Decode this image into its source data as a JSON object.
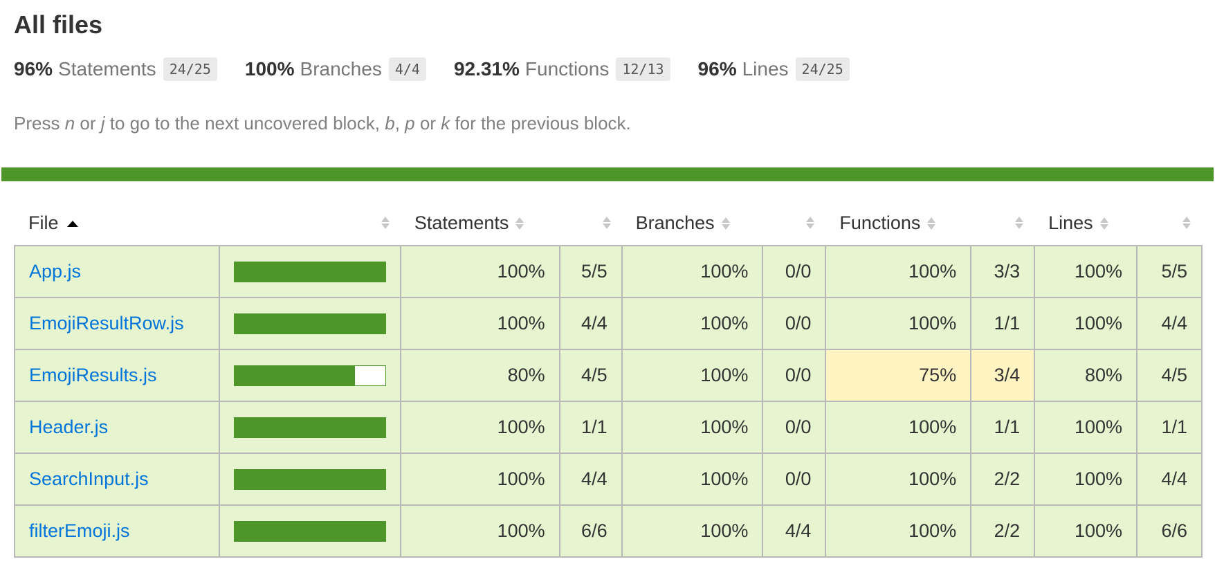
{
  "title": "All files",
  "summary": [
    {
      "pct": "96%",
      "label": "Statements",
      "frac": "24/25"
    },
    {
      "pct": "100%",
      "label": "Branches",
      "frac": "4/4"
    },
    {
      "pct": "92.31%",
      "label": "Functions",
      "frac": "12/13"
    },
    {
      "pct": "96%",
      "label": "Lines",
      "frac": "24/25"
    }
  ],
  "hint": {
    "t1": "Press ",
    "k1": "n",
    "t2": " or ",
    "k2": "j",
    "t3": " to go to the next uncovered block, ",
    "k3": "b",
    "t4": ", ",
    "k4": "p",
    "t5": " or ",
    "k5": "k",
    "t6": " for the previous block."
  },
  "columns": {
    "file": "File",
    "statements": "Statements",
    "branches": "Branches",
    "functions": "Functions",
    "lines": "Lines"
  },
  "colors": {
    "high": "#4f962a",
    "high_bg": "#e6f5d0",
    "medium_bg": "#fff4c2",
    "link": "#0074d9"
  },
  "rows": [
    {
      "file": "App.js",
      "coverage": 1.0,
      "stmt_pct": "100%",
      "stmt": "5/5",
      "br_pct": "100%",
      "br": "0/0",
      "fn_pct": "100%",
      "fn": "3/3",
      "ln_pct": "100%",
      "ln": "5/5"
    },
    {
      "file": "EmojiResultRow.js",
      "coverage": 1.0,
      "stmt_pct": "100%",
      "stmt": "4/4",
      "br_pct": "100%",
      "br": "0/0",
      "fn_pct": "100%",
      "fn": "1/1",
      "ln_pct": "100%",
      "ln": "4/4"
    },
    {
      "file": "EmojiResults.js",
      "coverage": 0.8,
      "stmt_pct": "80%",
      "stmt": "4/5",
      "br_pct": "100%",
      "br": "0/0",
      "fn_pct": "75%",
      "fn": "3/4",
      "ln_pct": "80%",
      "ln": "4/5"
    },
    {
      "file": "Header.js",
      "coverage": 1.0,
      "stmt_pct": "100%",
      "stmt": "1/1",
      "br_pct": "100%",
      "br": "0/0",
      "fn_pct": "100%",
      "fn": "1/1",
      "ln_pct": "100%",
      "ln": "1/1"
    },
    {
      "file": "SearchInput.js",
      "coverage": 1.0,
      "stmt_pct": "100%",
      "stmt": "4/4",
      "br_pct": "100%",
      "br": "0/0",
      "fn_pct": "100%",
      "fn": "2/2",
      "ln_pct": "100%",
      "ln": "4/4"
    },
    {
      "file": "filterEmoji.js",
      "coverage": 1.0,
      "stmt_pct": "100%",
      "stmt": "6/6",
      "br_pct": "100%",
      "br": "4/4",
      "fn_pct": "100%",
      "fn": "2/2",
      "ln_pct": "100%",
      "ln": "6/6"
    }
  ]
}
